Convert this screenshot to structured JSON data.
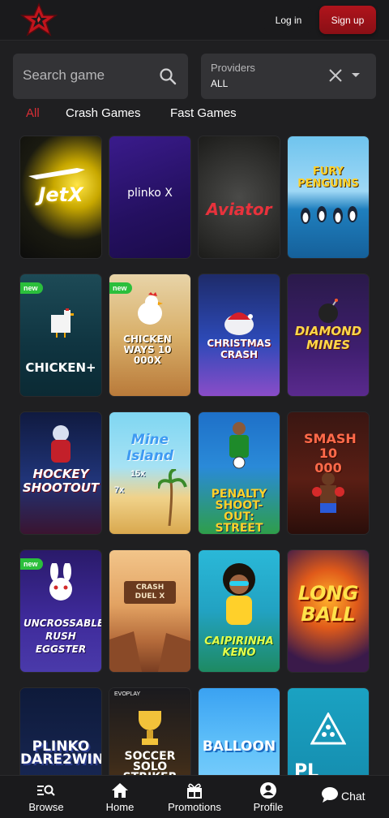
{
  "header": {
    "login_label": "Log in",
    "signup_label": "Sign up",
    "brand_color": "#b0141c"
  },
  "search": {
    "placeholder": "Search game"
  },
  "providers": {
    "label": "Providers",
    "value": "ALL"
  },
  "tabs": [
    {
      "label": "All",
      "active": true
    },
    {
      "label": "Crash Games",
      "active": false
    },
    {
      "label": "Fast Games",
      "active": false
    }
  ],
  "games": [
    {
      "title": "JetX",
      "new": false
    },
    {
      "title": "plinko X",
      "new": false
    },
    {
      "title": "Aviator",
      "new": false
    },
    {
      "title": "FURY PENGUINS",
      "new": false
    },
    {
      "title": "CHICKEN+",
      "new": true
    },
    {
      "title": "CHICKEN WAYS 10 000X",
      "new": true
    },
    {
      "title": "CHRISTMAS CRASH",
      "new": false
    },
    {
      "title": "DIAMOND MINES",
      "new": false
    },
    {
      "title": "HOCKEY SHOOTOUT",
      "new": false
    },
    {
      "title": "Mine Island",
      "new": false
    },
    {
      "title": "PENALTY SHOOT-OUT: STREET",
      "new": false
    },
    {
      "title": "SMASH 10 000",
      "new": false
    },
    {
      "title": "UNCROSSABLE RUSH EGGSTER",
      "new": true
    },
    {
      "title": "CRASH DUEL X",
      "new": false
    },
    {
      "title": "CAIPIRINHA KENO",
      "new": false
    },
    {
      "title": "LONG BALL",
      "new": false
    },
    {
      "title": "PLINKO DARE2WIN",
      "new": false
    },
    {
      "title": "SOCCER SOLO STRIKER",
      "new": false
    },
    {
      "title": "BALLOON",
      "new": false
    },
    {
      "title": "PL",
      "new": false
    }
  ],
  "card_extra": {
    "badge_new": "new",
    "multiplier_15x": "15x",
    "multiplier_7x": "7x",
    "evoplay": "EVOPLAY"
  },
  "bottom_nav": {
    "items": [
      {
        "label": "Browse",
        "icon": "browse-icon"
      },
      {
        "label": "Home",
        "icon": "home-icon"
      },
      {
        "label": "Promotions",
        "icon": "gift-icon"
      },
      {
        "label": "Profile",
        "icon": "profile-icon"
      }
    ],
    "chat_label": "Chat"
  }
}
